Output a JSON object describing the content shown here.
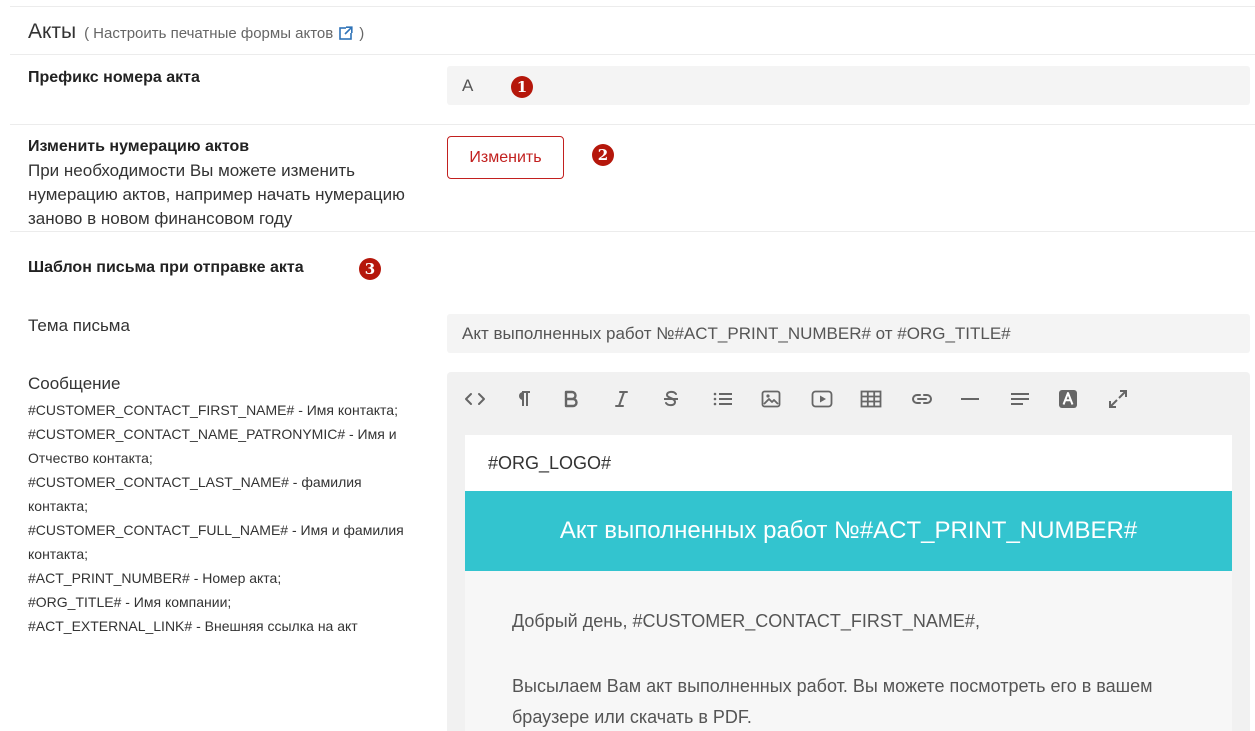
{
  "section": {
    "title": "Акты",
    "link_open": "(",
    "link_text": "Настроить печатные формы актов",
    "link_close": ")"
  },
  "prefix": {
    "label": "Префикс номера акта",
    "value": "А",
    "badge": "1"
  },
  "numbering": {
    "label": "Изменить нумерацию актов",
    "description": "При необходимости Вы можете изменить нумерацию актов, например начать нумерацию заново в новом финансовом году",
    "button_label": "Изменить",
    "badge": "2"
  },
  "template": {
    "label": "Шаблон письма при отправке акта",
    "badge": "3",
    "subject_label": "Тема письма",
    "subject_value": "Акт выполненных работ №#ACT_PRINT_NUMBER# от #ORG_TITLE#",
    "message_label": "Сообщение",
    "variables": [
      "#CUSTOMER_CONTACT_FIRST_NAME# - Имя контакта;",
      "#CUSTOMER_CONTACT_NAME_PATRONYMIC# - Имя и Отчество контакта;",
      "#CUSTOMER_CONTACT_LAST_NAME# - фамилия контакта;",
      "#CUSTOMER_CONTACT_FULL_NAME# - Имя и фамилия контакта;",
      "#ACT_PRINT_NUMBER# - Номер акта;",
      "#ORG_TITLE# - Имя компании;",
      "#ACT_EXTERNAL_LINK# - Внешняя ссылка на акт"
    ]
  },
  "editor": {
    "toolbar": [
      "code-view-icon",
      "paragraph-icon",
      "bold-icon",
      "italic-icon",
      "strikethrough-icon",
      "list-icon",
      "image-icon",
      "video-icon",
      "table-icon",
      "link-icon",
      "horizontal-rule-icon",
      "align-icon",
      "text-color-icon",
      "fullscreen-icon"
    ],
    "logo_placeholder": "#ORG_LOGO#",
    "banner_title": "Акт выполненных работ №#ACT_PRINT_NUMBER#",
    "greeting": "Добрый день, #CUSTOMER_CONTACT_FIRST_NAME#,",
    "paragraph": "Высылаем Вам акт выполненных работ. Вы можете посмотреть его в вашем браузере или скачать в PDF."
  },
  "colors": {
    "accent_red": "#c2201f",
    "badge_red": "#b5170b",
    "banner_teal": "#33c4cf",
    "link_icon_blue": "#2f73b8"
  }
}
